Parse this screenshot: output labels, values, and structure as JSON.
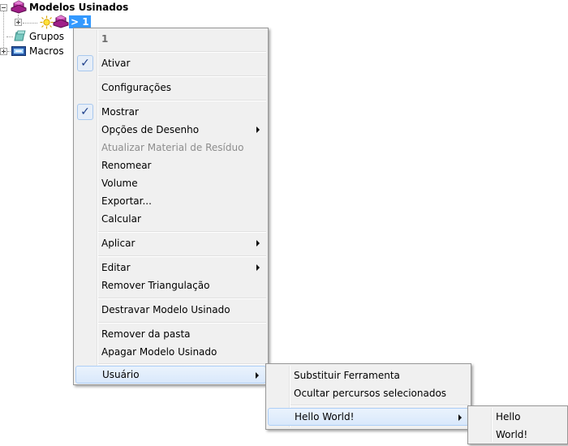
{
  "tree": {
    "root_label": "Modelos Usinados",
    "selected_item_label": "> 1",
    "groups_label": "Grupos",
    "macros_label": "Macros"
  },
  "context_menu": {
    "header": "1",
    "items": {
      "ativar": "Ativar",
      "configuracoes": "Configurações",
      "mostrar": "Mostrar",
      "opcoes_desenho": "Opções de Desenho",
      "atualizar_material": "Atualizar Material de Resíduo",
      "renomear": "Renomear",
      "volume": "Volume",
      "exportar": "Exportar...",
      "calcular": "Calcular",
      "aplicar": "Aplicar",
      "editar": "Editar",
      "remover_triangulacao": "Remover Triangulação",
      "destravar": "Destravar Modelo Usinado",
      "remover_pasta": "Remover da pasta",
      "apagar": "Apagar Modelo Usinado",
      "usuario": "Usuário"
    },
    "checked": [
      "Ativar",
      "Mostrar"
    ]
  },
  "submenu_usuario": {
    "items": {
      "substituir": "Substituir Ferramenta",
      "ocultar": "Ocultar percursos selecionados",
      "hello_world": "Hello World!"
    }
  },
  "submenu_hello_world": {
    "items": {
      "hello": "Hello",
      "world": "World!"
    }
  },
  "colors": {
    "selection": "#3399ff",
    "menu_background": "#f0f0f0",
    "highlight_border": "#aecff7",
    "model_icon": "#b0208f"
  },
  "icons": [
    "machined-model-icon",
    "sun-icon",
    "group-icon",
    "macro-icon",
    "checkmark-icon",
    "submenu-arrow-icon"
  ]
}
